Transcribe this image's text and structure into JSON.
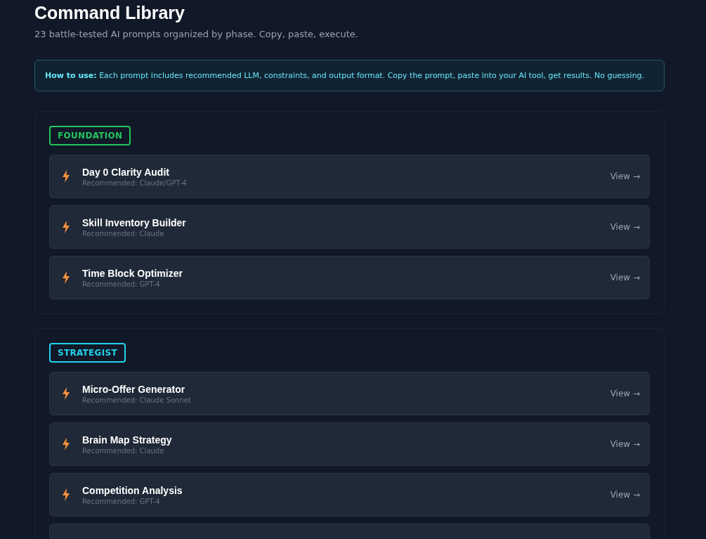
{
  "header": {
    "title": "Command Library",
    "subtitle": "23 battle-tested AI prompts organized by phase. Copy, paste, execute."
  },
  "notice": {
    "text": "**How to use:** Each prompt includes recommended LLM, constraints, and output format. Copy the prompt, paste into your AI tool, get results. No guessing."
  },
  "phases": [
    {
      "name": "FOUNDATION",
      "color": "#22c55e",
      "prompts": [
        {
          "title": "Day 0 Clarity Audit",
          "recommended": "Recommended: Claude/GPT-4",
          "action": "View →"
        },
        {
          "title": "Skill Inventory Builder",
          "recommended": "Recommended: Claude",
          "action": "View →"
        },
        {
          "title": "Time Block Optimizer",
          "recommended": "Recommended: GPT-4",
          "action": "View →"
        }
      ]
    },
    {
      "name": "STRATEGIST",
      "color": "#22d3ee",
      "prompts": [
        {
          "title": "Micro-Offer Generator",
          "recommended": "Recommended: Claude Sonnet",
          "action": "View →"
        },
        {
          "title": "Brain Map Strategy",
          "recommended": "Recommended: Claude",
          "action": "View →"
        },
        {
          "title": "Competition Analysis",
          "recommended": "Recommended: GPT-4",
          "action": "View →"
        }
      ]
    }
  ]
}
